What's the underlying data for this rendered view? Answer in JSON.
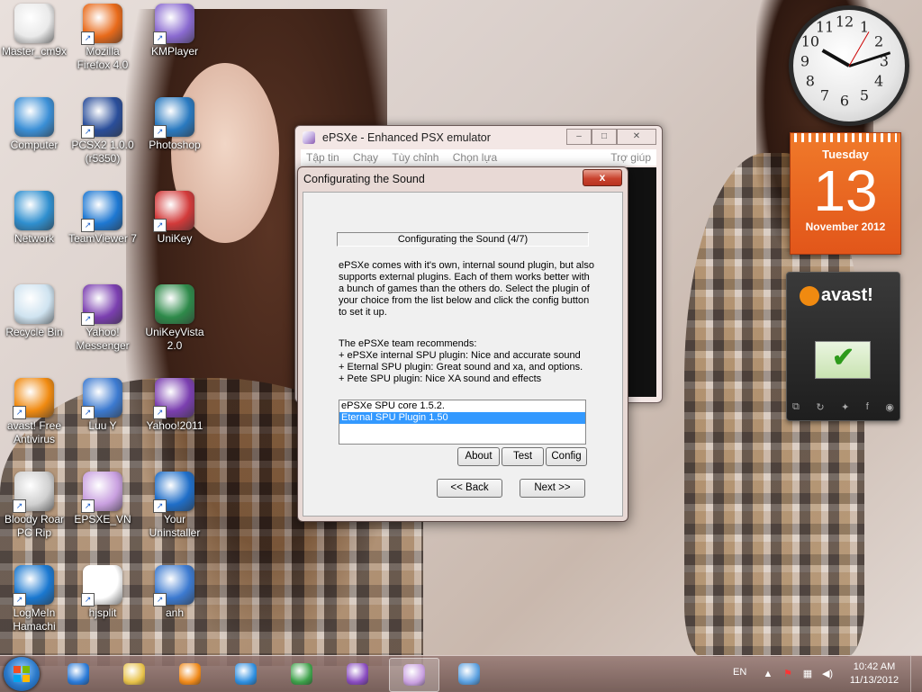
{
  "desktop_icons": [
    {
      "label": "Master_cm9x",
      "color": "#eaeaea",
      "shortcut": false
    },
    {
      "label": "Mozilla Firefox 4.0",
      "color": "#e86a1a",
      "shortcut": true
    },
    {
      "label": "KMPlayer",
      "color": "#8a6ad0",
      "shortcut": true
    },
    {
      "label": "Computer",
      "color": "#3b8fd6",
      "shortcut": false
    },
    {
      "label": "PCSX2 1.0.0 (r5350)",
      "color": "#2a4e9a",
      "shortcut": true
    },
    {
      "label": "Photoshop",
      "color": "#2a7ac0",
      "shortcut": true
    },
    {
      "label": "Network",
      "color": "#2f8fcf",
      "shortcut": false
    },
    {
      "label": "TeamViewer 7",
      "color": "#1e78d2",
      "shortcut": true
    },
    {
      "label": "UniKey",
      "color": "#d23a3a",
      "shortcut": true
    },
    {
      "label": "Recycle Bin",
      "color": "#cfe3f0",
      "shortcut": false
    },
    {
      "label": "Yahoo! Messenger",
      "color": "#7b3fb0",
      "shortcut": true
    },
    {
      "label": "UniKeyVista 2.0",
      "color": "#2e8a4a",
      "shortcut": false
    },
    {
      "label": "avast! Free Antivirus",
      "color": "#f08a10",
      "shortcut": true
    },
    {
      "label": "Luu Y",
      "color": "#3c7ad0",
      "shortcut": true
    },
    {
      "label": "Yahoo!2011",
      "color": "#7b3fb0",
      "shortcut": true
    },
    {
      "label": "Bloody Roar PC Rip",
      "color": "#d0d0d0",
      "shortcut": true
    },
    {
      "label": "EPSXE_VN",
      "color": "#c9a0e0",
      "shortcut": true
    },
    {
      "label": "Your Uninstaller",
      "color": "#1f6ec8",
      "shortcut": true
    },
    {
      "label": "LogMeIn Hamachi",
      "color": "#1a78d0",
      "shortcut": true
    },
    {
      "label": "hjsplit",
      "color": "#ffffff",
      "shortcut": true
    },
    {
      "label": "anh",
      "color": "#3c7ad0",
      "shortcut": true
    }
  ],
  "main_window": {
    "title": "ePSXe - Enhanced PSX emulator",
    "minimize": "–",
    "maximize": "□",
    "close": "✕",
    "menu": [
      "Tập tin",
      "Chạy",
      "Tùy chỉnh",
      "Chọn lựa",
      "Trợ giúp"
    ]
  },
  "dialog": {
    "title": "Configurating the Sound",
    "close": "x",
    "banner": "Configurating the Sound (4/7)",
    "description": "ePSXe comes with it's own, internal sound plugin, but also supports external plugins. Each of them works better with a bunch of games than the others do. Select the plugin of your choice from the list below and click the config button to set it up.",
    "recommend_title": "The ePSXe team recommends:",
    "recommend_lines": [
      "+ ePSXe internal SPU plugin: Nice and accurate sound",
      "+ Eternal SPU plugin: Great sound and xa, and options.",
      "+ Pete SPU plugin: Nice XA sound and effects"
    ],
    "plugins": [
      "ePSXe SPU core 1.5.2.",
      "Eternal SPU Plugin 1.50"
    ],
    "selected_plugin": "Eternal SPU Plugin 1.50",
    "buttons": {
      "about": "About",
      "test": "Test",
      "config": "Config",
      "back": "<< Back",
      "next": "Next >>"
    }
  },
  "gadgets": {
    "clock": {
      "numbers": [
        "12",
        "1",
        "2",
        "3",
        "4",
        "5",
        "6",
        "7",
        "8",
        "9",
        "10",
        "11"
      ]
    },
    "calendar": {
      "weekday": "Tuesday",
      "day": "13",
      "month_year": "November 2012"
    },
    "avast": {
      "logo": "avast!"
    }
  },
  "taskbar": {
    "language": "EN",
    "time": "10:42 AM",
    "date": "11/13/2012",
    "pinned": [
      {
        "name": "taskbar-teamviewer",
        "color": "#2a7ad8",
        "active": false
      },
      {
        "name": "taskbar-explorer",
        "color": "#e8c24a",
        "active": false
      },
      {
        "name": "taskbar-media-player",
        "color": "#f08a1a",
        "active": false
      },
      {
        "name": "taskbar-internet-explorer",
        "color": "#2f8fe0",
        "active": false
      },
      {
        "name": "taskbar-chrome",
        "color": "#3ea14a",
        "active": false
      },
      {
        "name": "taskbar-yahoo-messenger",
        "color": "#8a4cc0",
        "active": false
      },
      {
        "name": "taskbar-epsxe",
        "color": "#c9a0e0",
        "active": true
      },
      {
        "name": "taskbar-paint",
        "color": "#5aa0e0",
        "active": false
      }
    ]
  }
}
